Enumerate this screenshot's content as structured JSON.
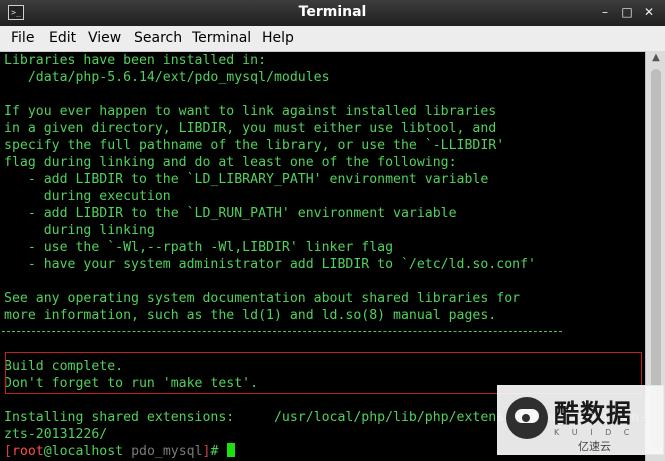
{
  "window": {
    "title": "Terminal",
    "icon": "terminal-icon",
    "controls": [
      "minimize-icon",
      "maximize-icon",
      "close-icon"
    ]
  },
  "menu": [
    "File",
    "Edit",
    "View",
    "Search",
    "Terminal",
    "Help"
  ],
  "terminal": {
    "lines": [
      "Libraries have been installed in:",
      "   /data/php-5.6.14/ext/pdo_mysql/modules",
      "",
      "If you ever happen to want to link against installed libraries",
      "in a given directory, LIBDIR, you must either use libtool, and",
      "specify the full pathname of the library, or use the `-LLIBDIR'",
      "flag during linking and do at least one of the following:",
      "   - add LIBDIR to the `LD_LIBRARY_PATH' environment variable",
      "     during execution",
      "   - add LIBDIR to the `LD_RUN_PATH' environment variable",
      "     during linking",
      "   - use the `-Wl,--rpath -Wl,LIBDIR' linker flag",
      "   - have your system administrator add LIBDIR to `/etc/ld.so.conf'",
      "",
      "See any operating system documentation about shared libraries for",
      "more information, such as the ld(1) and ld.so(8) manual pages.",
      "",
      "",
      "Build complete.",
      "Don't forget to run 'make test'.",
      "",
      "Installing shared extensions:     /usr/local/php/lib/php/extensions/no-debug-non-",
      "zts-20131226/"
    ],
    "prompt": {
      "open_bracket": "[",
      "user": "root",
      "host": "@localhost",
      "cwd": "pdo_mysql",
      "close_bracket": "]",
      "symbol": "# "
    },
    "colors": {
      "foreground": "#51d15b",
      "background": "#000000",
      "cursor": "#1de00f",
      "prompt_user": "#ff4d4d",
      "highlight_box": "#c02020"
    }
  },
  "watermark": {
    "title": "酷数据",
    "letters": "K U I D C",
    "tagline": "亿速云"
  },
  "scrollbar": {
    "up_arrow": "chevron-up-icon"
  }
}
